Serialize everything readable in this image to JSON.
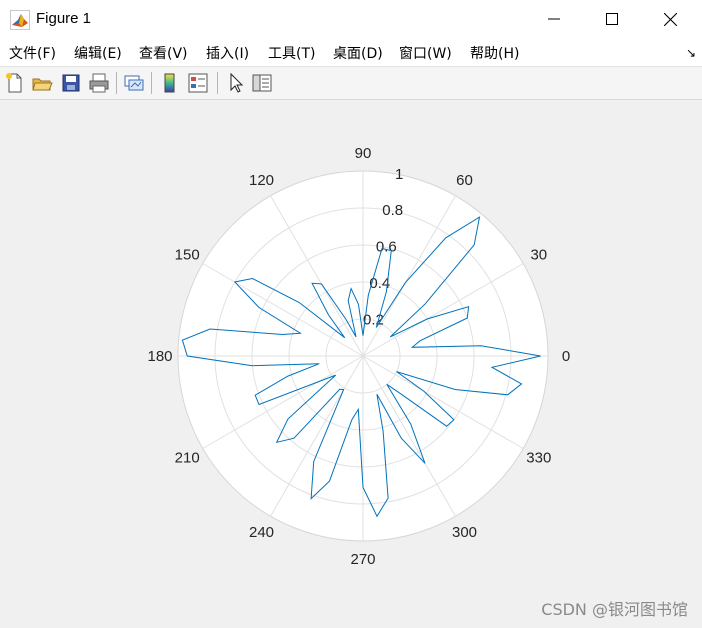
{
  "window": {
    "title": "Figure 1",
    "controls": {
      "minimize": "minimize-icon",
      "maximize": "maximize-icon",
      "close": "close-icon"
    }
  },
  "menu": {
    "items": [
      "文件(F)",
      "编辑(E)",
      "查看(V)",
      "插入(I)",
      "工具(T)",
      "桌面(D)",
      "窗口(W)",
      "帮助(H)"
    ],
    "expand_icon": "dock-arrow-icon"
  },
  "toolbar": {
    "buttons": [
      "new-figure-icon",
      "open-file-icon",
      "save-icon",
      "print-icon",
      "link-plot-icon",
      "colorbar-icon",
      "legend-icon",
      "pointer-icon",
      "property-inspector-icon"
    ]
  },
  "chart_data": {
    "type": "polar-line",
    "theta_ticks": [
      "0",
      "30",
      "60",
      "90",
      "120",
      "150",
      "180",
      "210",
      "240",
      "270",
      "300",
      "330"
    ],
    "r_ticks": [
      "0.2",
      "0.4",
      "0.6",
      "0.8",
      "1"
    ],
    "rlim": [
      0,
      1
    ],
    "grid": true,
    "line_color": "#0072bd",
    "series": [
      {
        "theta_deg": [
          0,
          5,
          10,
          15,
          20,
          25,
          30,
          35,
          40,
          45,
          50,
          55,
          60,
          65,
          70,
          75,
          80,
          85,
          90,
          95,
          100,
          105,
          110,
          115,
          120,
          125,
          130,
          135,
          140,
          145,
          150,
          155,
          160,
          165,
          170,
          175,
          180,
          185,
          190,
          195,
          200,
          205,
          210,
          215,
          220,
          225,
          230,
          235,
          240,
          245,
          250,
          255,
          260,
          265,
          270,
          275,
          280,
          285,
          290,
          295,
          300,
          305,
          310,
          315,
          320,
          325,
          330,
          335,
          340,
          345,
          350,
          355,
          360
        ],
        "r": [
          0.96,
          0.64,
          0.27,
          0.32,
          0.6,
          0.63,
          0.4,
          0.18,
          0.44,
          0.85,
          0.98,
          0.78,
          0.46,
          0.17,
          0.37,
          0.59,
          0.59,
          0.33,
          0.11,
          0.28,
          0.37,
          0.31,
          0.11,
          0.22,
          0.45,
          0.48,
          0.29,
          0.14,
          0.45,
          0.73,
          0.8,
          0.62,
          0.36,
          0.45,
          0.84,
          0.98,
          0.95,
          0.6,
          0.24,
          0.42,
          0.62,
          0.62,
          0.28,
          0.18,
          0.53,
          0.66,
          0.58,
          0.22,
          0.21,
          0.63,
          0.82,
          0.7,
          0.35,
          0.29,
          0.71,
          0.87,
          0.78,
          0.42,
          0.22,
          0.49,
          0.67,
          0.45,
          0.2,
          0.29,
          0.59,
          0.6,
          0.38,
          0.2,
          0.53,
          0.81,
          0.87,
          0.7,
          0.96
        ]
      }
    ]
  },
  "watermark": "CSDN @银河图书馆"
}
